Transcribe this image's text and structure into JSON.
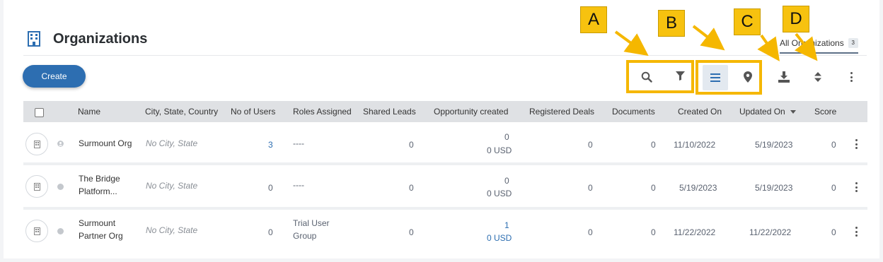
{
  "header": {
    "title": "Organizations",
    "tab_label": "All Organizations",
    "tab_count": "3"
  },
  "toolbar": {
    "create_label": "Create",
    "icons": [
      "search-icon",
      "filter-icon",
      "list-view-icon",
      "map-pin-icon",
      "download-icon",
      "sort-icon",
      "more-vertical-icon"
    ]
  },
  "callouts": {
    "a": "A",
    "b": "B",
    "c": "C",
    "d": "D",
    "color": "#f5b700"
  },
  "table": {
    "columns": [
      "Name",
      "City, State, Country",
      "No of Users",
      "Roles Assigned",
      "Shared Leads",
      "Opportunity created",
      "Registered Deals",
      "Documents",
      "Created On",
      "Updated On",
      "Score"
    ],
    "rows": [
      {
        "name_line1": "Surmount Org",
        "name_line2": "",
        "city": "No City, State",
        "users": "3",
        "roles_line1": "----",
        "roles_line2": "",
        "shared_leads": "0",
        "opportunity_count": "0",
        "opportunity_amount": "0 USD",
        "registered_deals": "0",
        "documents": "0",
        "created_on": "11/10/2022",
        "updated_on": "5/19/2023",
        "score": "0"
      },
      {
        "name_line1": "The Bridge",
        "name_line2": "Platform...",
        "city": "No City, State",
        "users": "0",
        "roles_line1": "----",
        "roles_line2": "",
        "shared_leads": "0",
        "opportunity_count": "0",
        "opportunity_amount": "0 USD",
        "registered_deals": "0",
        "documents": "0",
        "created_on": "5/19/2023",
        "updated_on": "5/19/2023",
        "score": "0"
      },
      {
        "name_line1": "Surmount",
        "name_line2": "Partner Org",
        "city": "No City, State",
        "users": "0",
        "roles_line1": "Trial User",
        "roles_line2": "Group",
        "shared_leads": "0",
        "opportunity_count": "1",
        "opportunity_amount": "0 USD",
        "registered_deals": "0",
        "documents": "0",
        "created_on": "11/22/2022",
        "updated_on": "11/22/2022",
        "score": "0"
      }
    ]
  },
  "colors": {
    "accent": "#2d6eb1",
    "callout": "#f5b700",
    "header_bg": "#dfe1e4"
  }
}
